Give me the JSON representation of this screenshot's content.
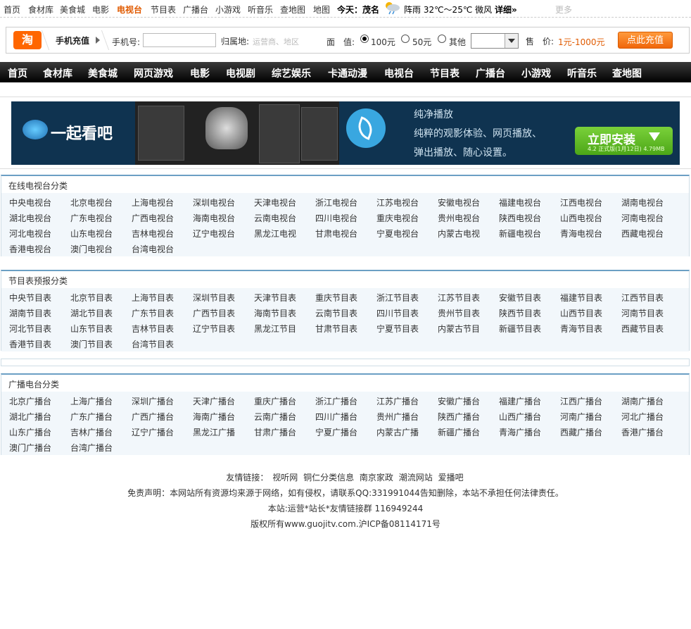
{
  "topnav": {
    "items": [
      {
        "label": "首页",
        "active": false
      },
      {
        "label": "食材库",
        "active": false
      },
      {
        "label": "美食城",
        "active": false
      },
      {
        "label": "电影",
        "active": false
      },
      {
        "label": "电视台",
        "active": true
      },
      {
        "label": "节目表",
        "active": false
      },
      {
        "label": "广播台",
        "active": false
      },
      {
        "label": "小游戏",
        "active": false
      },
      {
        "label": "听音乐",
        "active": false
      },
      {
        "label": "查地图",
        "active": false
      },
      {
        "label": "地图",
        "active": false
      }
    ],
    "today_label": "今天：茂名",
    "weather": "阵雨 32℃～25℃ 微风",
    "detail_label": "详细»",
    "more_label": "更多"
  },
  "recharge": {
    "logo": "淘",
    "title": "手机充值",
    "phone_label": "手机号:",
    "phone_value": "",
    "area_label": "归属地:",
    "area_value": "运营商、地区",
    "face_label": "面　值:",
    "options": [
      "100元",
      "50元",
      "其他"
    ],
    "selected_option": "100元",
    "select_value": "",
    "price_label": "售　价:",
    "price_value": "1元-1000元",
    "submit_label": "点此充值"
  },
  "mainnav": {
    "items": [
      "首页",
      "食材库",
      "美食城",
      "网页游戏",
      "电影",
      "电视剧",
      "综艺娱乐",
      "卡通动漫",
      "电视台",
      "节目表",
      "广播台",
      "小游戏",
      "听音乐",
      "查地图"
    ]
  },
  "banner": {
    "logo_text": "一起看吧",
    "line1": "纯净播放",
    "line2": "纯粹的观影体验、网页播放、",
    "line3": "弹出播放、随心设置。",
    "install_label": "立即安装",
    "install_version": "4.2 正式版(1月12日) 4.79MB"
  },
  "tv_section": {
    "title": "在线电视台分类",
    "links": [
      "中央电视台",
      "北京电视台",
      "上海电视台",
      "深圳电视台",
      "天津电视台",
      "浙江电视台",
      "江苏电视台",
      "安徽电视台",
      "福建电视台",
      "江西电视台",
      "湖南电视台",
      "湖北电视台",
      "广东电视台",
      "广西电视台",
      "海南电视台",
      "云南电视台",
      "四川电视台",
      "重庆电视台",
      "贵州电视台",
      "陕西电视台",
      "山西电视台",
      "河南电视台",
      "河北电视台",
      "山东电视台",
      "吉林电视台",
      "辽宁电视台",
      "黑龙江电视",
      "甘肃电视台",
      "宁夏电视台",
      "内蒙古电视",
      "新疆电视台",
      "青海电视台",
      "西藏电视台",
      "香港电视台",
      "澳门电视台",
      "台湾电视台"
    ]
  },
  "schedule_section": {
    "title": "节目表预报分类",
    "links": [
      "中央节目表",
      "北京节目表",
      "上海节目表",
      "深圳节目表",
      "天津节目表",
      "重庆节目表",
      "浙江节目表",
      "江苏节目表",
      "安徽节目表",
      "福建节目表",
      "江西节目表",
      "湖南节目表",
      "湖北节目表",
      "广东节目表",
      "广西节目表",
      "海南节目表",
      "云南节目表",
      "四川节目表",
      "贵州节目表",
      "陕西节目表",
      "山西节目表",
      "河南节目表",
      "河北节目表",
      "山东节目表",
      "吉林节目表",
      "辽宁节目表",
      "黑龙江节目",
      "甘肃节目表",
      "宁夏节目表",
      "内蒙古节目",
      "新疆节目表",
      "青海节目表",
      "西藏节目表",
      "香港节目表",
      "澳门节目表",
      "台湾节目表"
    ]
  },
  "radio_section": {
    "title": "广播电台分类",
    "links": [
      "北京广播台",
      "上海广播台",
      "深圳广播台",
      "天津广播台",
      "重庆广播台",
      "浙江广播台",
      "江苏广播台",
      "安徽广播台",
      "福建广播台",
      "江西广播台",
      "湖南广播台",
      "湖北广播台",
      "广东广播台",
      "广西广播台",
      "海南广播台",
      "云南广播台",
      "四川广播台",
      "贵州广播台",
      "陕西广播台",
      "山西广播台",
      "河南广播台",
      "河北广播台",
      "山东广播台",
      "吉林广播台",
      "辽宁广播台",
      "黑龙江广播",
      "甘肃广播台",
      "宁夏广播台",
      "内蒙古广播",
      "新疆广播台",
      "青海广播台",
      "西藏广播台",
      "香港广播台",
      "澳门广播台",
      "台湾广播台"
    ]
  },
  "footer": {
    "friend_label": "友情链接：",
    "friend_links": [
      "视听网",
      "铜仁分类信息",
      "南京家政",
      "潮流网站",
      "爱播吧"
    ],
    "disclaimer": "免责声明：本网站所有资源均来源于网络，如有侵权，请联系QQ:331991044告知删除，本站不承担任何法律责任。",
    "contact": "本站:运营*站长*友情链接群 116949244",
    "copyright": "版权所有www.guojitv.com.沪ICP备08114171号"
  },
  "colors": {
    "accent": "#e05a00",
    "nav_bg": "#000000",
    "section_border": "#6b9fc4",
    "link_bg": "#f2f7fb"
  }
}
